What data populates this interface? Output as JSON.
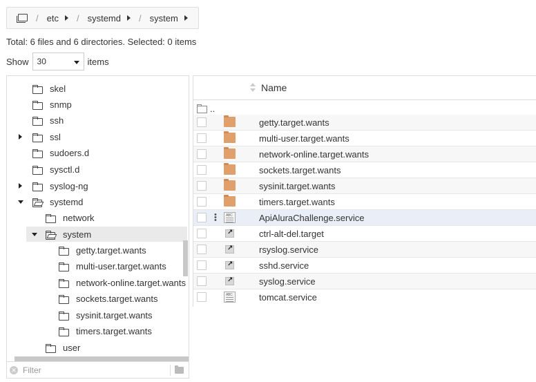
{
  "breadcrumb": {
    "root_icon": "folder-root-icon",
    "separator": "/",
    "items": [
      "etc",
      "systemd",
      "system"
    ]
  },
  "status": {
    "summary": "Total: 6 files and 6 directories. Selected: 0 items"
  },
  "paging": {
    "show_label": "Show",
    "value": "30",
    "items_label": "items"
  },
  "tree": {
    "items": [
      {
        "label": "skel"
      },
      {
        "label": "snmp"
      },
      {
        "label": "ssh"
      },
      {
        "label": "ssl"
      },
      {
        "label": "sudoers.d"
      },
      {
        "label": "sysctl.d"
      },
      {
        "label": "syslog-ng"
      },
      {
        "label": "systemd"
      },
      {
        "label": "network"
      },
      {
        "label": "system"
      },
      {
        "label": "getty.target.wants"
      },
      {
        "label": "multi-user.target.wants"
      },
      {
        "label": "network-online.target.wants"
      },
      {
        "label": "sockets.target.wants"
      },
      {
        "label": "sysinit.target.wants"
      },
      {
        "label": "timers.target.wants"
      },
      {
        "label": "user"
      }
    ],
    "filter_placeholder": "Filter"
  },
  "list": {
    "header_name": "Name",
    "parent": "..",
    "rows": [
      {
        "name": "getty.target.wants",
        "icon": "folder-icon"
      },
      {
        "name": "multi-user.target.wants",
        "icon": "folder-icon"
      },
      {
        "name": "network-online.target.wants",
        "icon": "folder-icon"
      },
      {
        "name": "sockets.target.wants",
        "icon": "folder-icon"
      },
      {
        "name": "sysinit.target.wants",
        "icon": "folder-icon"
      },
      {
        "name": "timers.target.wants",
        "icon": "folder-icon"
      },
      {
        "name": "ApiAluraChallenge.service",
        "icon": "text-file-icon"
      },
      {
        "name": "ctrl-alt-del.target",
        "icon": "symlink-icon"
      },
      {
        "name": "rsyslog.service",
        "icon": "symlink-icon"
      },
      {
        "name": "sshd.service",
        "icon": "symlink-icon"
      },
      {
        "name": "syslog.service",
        "icon": "symlink-icon"
      },
      {
        "name": "tomcat.service",
        "icon": "text-file-icon"
      }
    ]
  },
  "colors": {
    "folder": "#e0a06b",
    "row_highlight": "#e9eef7",
    "selected_tree": "#eaeaea"
  }
}
